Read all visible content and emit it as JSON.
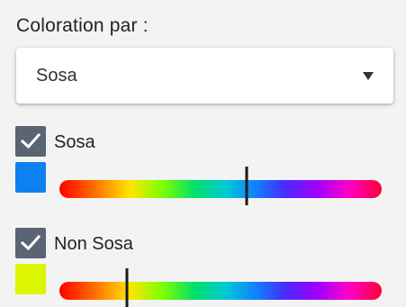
{
  "coloration": {
    "label": "Coloration par :",
    "select": {
      "value": "Sosa"
    }
  },
  "groups": [
    {
      "label": "Sosa",
      "checked": true,
      "swatch_color": "#0d80f2",
      "slider_position": 0.58
    },
    {
      "label": "Non Sosa",
      "checked": true,
      "swatch_color": "#dcf500",
      "slider_position": 0.21
    }
  ]
}
